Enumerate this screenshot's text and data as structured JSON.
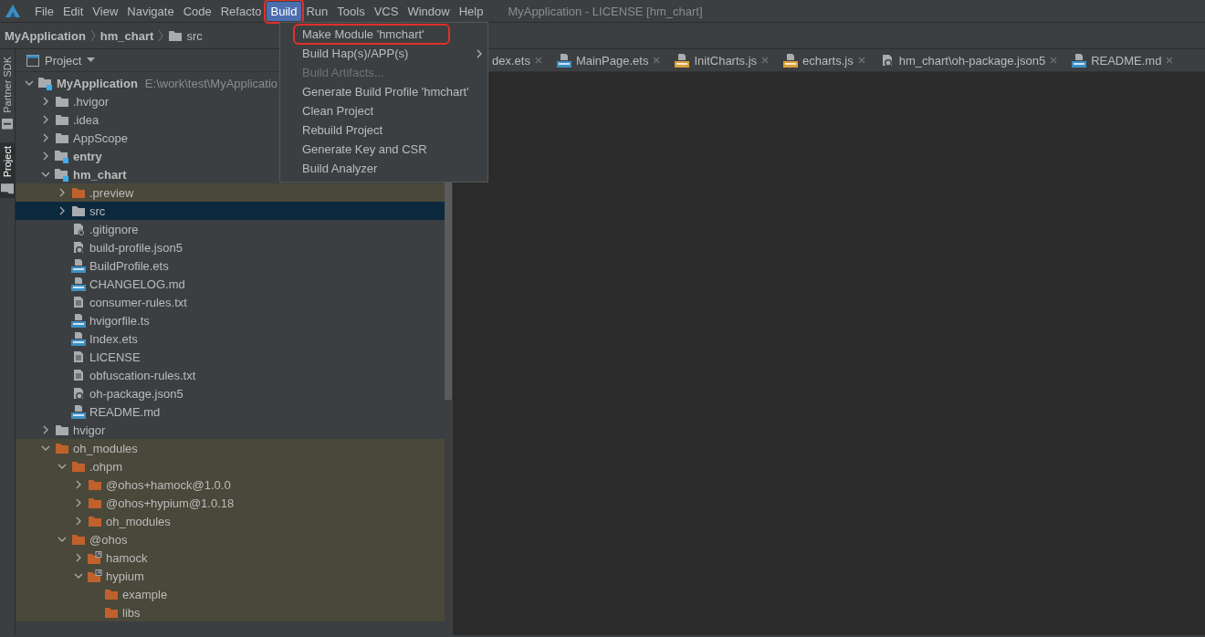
{
  "menubar": {
    "items": [
      {
        "label": "File",
        "selected": false,
        "annotated": false
      },
      {
        "label": "Edit",
        "selected": false,
        "annotated": false
      },
      {
        "label": "View",
        "selected": false,
        "annotated": false
      },
      {
        "label": "Navigate",
        "selected": false,
        "annotated": false
      },
      {
        "label": "Code",
        "selected": false,
        "annotated": false
      },
      {
        "label": "Refacto",
        "selected": false,
        "annotated": false
      },
      {
        "label": "Build",
        "selected": true,
        "annotated": true
      },
      {
        "label": "Run",
        "selected": false,
        "annotated": false
      },
      {
        "label": "Tools",
        "selected": false,
        "annotated": false
      },
      {
        "label": "VCS",
        "selected": false,
        "annotated": false
      },
      {
        "label": "Window",
        "selected": false,
        "annotated": false
      },
      {
        "label": "Help",
        "selected": false,
        "annotated": false
      }
    ],
    "title": "MyApplication - LICENSE [hm_chart]"
  },
  "breadcrumb": [
    {
      "label": "MyApplication",
      "kind": "project"
    },
    {
      "label": "hm_chart",
      "kind": "module"
    },
    {
      "label": "src",
      "kind": "folder"
    }
  ],
  "tool_strip": [
    {
      "label": "Partner SDK",
      "selected": false
    },
    {
      "label": "Project",
      "selected": true
    }
  ],
  "project_panel": {
    "title": "Project",
    "tree": [
      {
        "label": "MyApplication",
        "path": "E:\\work\\test\\MyApplicatio",
        "kind": "project",
        "expanded": true,
        "selected": false,
        "excluded": false,
        "children": [
          {
            "label": ".hvigor",
            "kind": "folder",
            "expanded": false,
            "selected": false,
            "excluded": false
          },
          {
            "label": ".idea",
            "kind": "folder",
            "expanded": false,
            "selected": false,
            "excluded": false
          },
          {
            "label": "AppScope",
            "kind": "folder",
            "expanded": false,
            "selected": false,
            "excluded": false
          },
          {
            "label": "entry",
            "kind": "module",
            "expanded": false,
            "selected": false,
            "excluded": false
          },
          {
            "label": "hm_chart",
            "kind": "module",
            "expanded": true,
            "selected": false,
            "excluded": false,
            "children": [
              {
                "label": ".preview",
                "kind": "folder",
                "expanded": false,
                "selected": false,
                "excluded": true
              },
              {
                "label": "src",
                "kind": "folder",
                "expanded": false,
                "selected": true,
                "excluded": false
              },
              {
                "label": ".gitignore",
                "kind": "ignore",
                "selected": false,
                "excluded": false
              },
              {
                "label": "build-profile.json5",
                "kind": "json",
                "selected": false,
                "excluded": false
              },
              {
                "label": "BuildProfile.ets",
                "kind": "ets",
                "selected": false,
                "excluded": false
              },
              {
                "label": "CHANGELOG.md",
                "kind": "md",
                "selected": false,
                "excluded": false
              },
              {
                "label": "consumer-rules.txt",
                "kind": "text",
                "selected": false,
                "excluded": false
              },
              {
                "label": "hvigorfile.ts",
                "kind": "ts",
                "selected": false,
                "excluded": false
              },
              {
                "label": "Index.ets",
                "kind": "ets",
                "selected": false,
                "excluded": false
              },
              {
                "label": "LICENSE",
                "kind": "text",
                "selected": false,
                "excluded": false
              },
              {
                "label": "obfuscation-rules.txt",
                "kind": "text",
                "selected": false,
                "excluded": false
              },
              {
                "label": "oh-package.json5",
                "kind": "json",
                "selected": false,
                "excluded": false
              },
              {
                "label": "README.md",
                "kind": "md",
                "selected": false,
                "excluded": false
              }
            ]
          },
          {
            "label": "hvigor",
            "kind": "folder",
            "expanded": false,
            "selected": false,
            "excluded": false
          },
          {
            "label": "oh_modules",
            "kind": "folder",
            "expanded": true,
            "selected": false,
            "excluded": true,
            "children": [
              {
                "label": ".ohpm",
                "kind": "folder",
                "expanded": true,
                "selected": false,
                "excluded": true,
                "children": [
                  {
                    "label": "@ohos+hamock@1.0.0",
                    "kind": "folder",
                    "expanded": false,
                    "selected": false,
                    "excluded": true
                  },
                  {
                    "label": "@ohos+hypium@1.0.18",
                    "kind": "folder",
                    "expanded": false,
                    "selected": false,
                    "excluded": true
                  },
                  {
                    "label": "oh_modules",
                    "kind": "folder",
                    "expanded": false,
                    "selected": false,
                    "excluded": true
                  }
                ]
              },
              {
                "label": "@ohos",
                "kind": "folder",
                "expanded": true,
                "selected": false,
                "excluded": true,
                "children": [
                  {
                    "label": "hamock",
                    "kind": "link",
                    "expanded": false,
                    "selected": false,
                    "excluded": true
                  },
                  {
                    "label": "hypium",
                    "kind": "link",
                    "expanded": true,
                    "selected": false,
                    "excluded": true,
                    "children": [
                      {
                        "label": "example",
                        "kind": "folder",
                        "selected": false,
                        "excluded": true
                      },
                      {
                        "label": "libs",
                        "kind": "folder",
                        "selected": false,
                        "excluded": true
                      }
                    ]
                  }
                ]
              }
            ]
          }
        ]
      }
    ]
  },
  "build_menu": {
    "items": [
      {
        "label": "Make Module 'hmchart'",
        "disabled": false,
        "submenu": false,
        "annotated": true
      },
      {
        "label": "Build Hap(s)/APP(s)",
        "disabled": false,
        "submenu": true,
        "annotated": false
      },
      {
        "label": "Build Artifacts...",
        "disabled": true,
        "submenu": false,
        "annotated": false
      },
      {
        "label": "Generate Build Profile 'hmchart'",
        "disabled": false,
        "submenu": false,
        "annotated": false
      },
      {
        "label": "Clean Project",
        "disabled": false,
        "submenu": false,
        "annotated": false
      },
      {
        "label": "Rebuild Project",
        "disabled": false,
        "submenu": false,
        "annotated": false
      },
      {
        "label": "Generate Key and CSR",
        "disabled": false,
        "submenu": false,
        "annotated": false
      },
      {
        "label": "Build Analyzer",
        "disabled": false,
        "submenu": false,
        "annotated": false
      }
    ]
  },
  "editor_tabs": [
    {
      "label": "dex.ets"
    },
    {
      "label": "MainPage.ets",
      "kind": "ets"
    },
    {
      "label": "InitCharts.js",
      "kind": "js"
    },
    {
      "label": "echarts.js",
      "kind": "js"
    },
    {
      "label": "hm_chart\\oh-package.json5",
      "kind": "json"
    },
    {
      "label": "README.md",
      "kind": "md"
    }
  ]
}
